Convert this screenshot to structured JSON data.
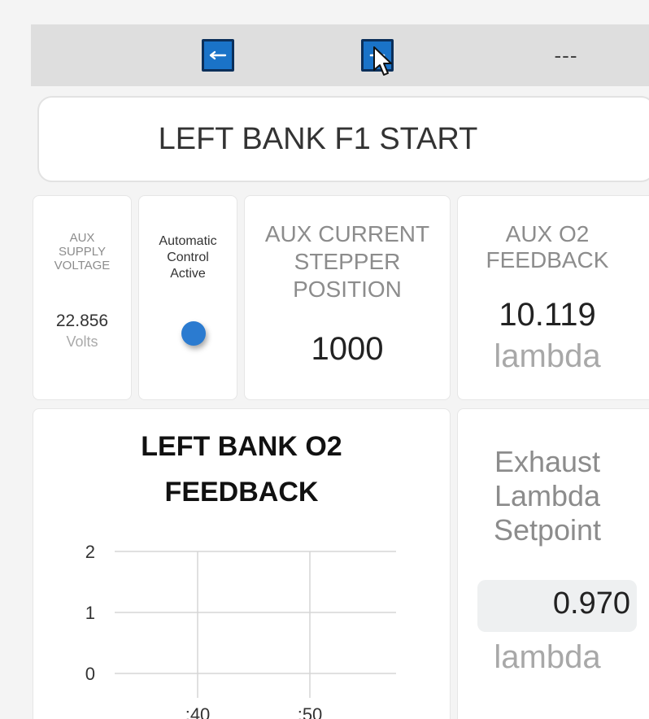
{
  "toolbar": {
    "back_button_icon": "left-arrow-icon",
    "minus_button_icon": "minus-icon",
    "status_text": "---",
    "accent_color": "#1a73c8"
  },
  "header": {
    "title": "LEFT BANK F1 START"
  },
  "cards": {
    "aux_supply_voltage": {
      "label_line1": "AUX",
      "label_line2": "SUPPLY",
      "label_line3": "VOLTAGE",
      "value": "22.856",
      "unit": "Volts"
    },
    "auto_control": {
      "label_line1": "Automatic",
      "label_line2": "Control",
      "label_line3": "Active",
      "indicator_color": "#2b7bd0"
    },
    "aux_current_stepper": {
      "label_line1": "AUX CURRENT",
      "label_line2": "STEPPER",
      "label_line3": "POSITION",
      "value": "1000"
    },
    "aux_o2_feedback": {
      "label_line1": "AUX O2",
      "label_line2": "FEEDBACK",
      "value": "10.119",
      "unit": "lambda"
    },
    "exhaust_setpoint": {
      "label_line1": "Exhaust",
      "label_line2": "Lambda",
      "label_line3": "Setpoint",
      "value": "0.970",
      "unit": "lambda"
    }
  },
  "chart_data": {
    "type": "line",
    "title": "LEFT BANK O2 FEEDBACK",
    "title_line1": "LEFT BANK O2",
    "title_line2": "FEEDBACK",
    "xlabel": "",
    "ylabel": "",
    "y_ticks": [
      "0",
      "1",
      "2"
    ],
    "x_ticks": [
      ":40",
      ":50"
    ],
    "ylim": [
      0,
      2
    ],
    "grid": true,
    "series": []
  }
}
